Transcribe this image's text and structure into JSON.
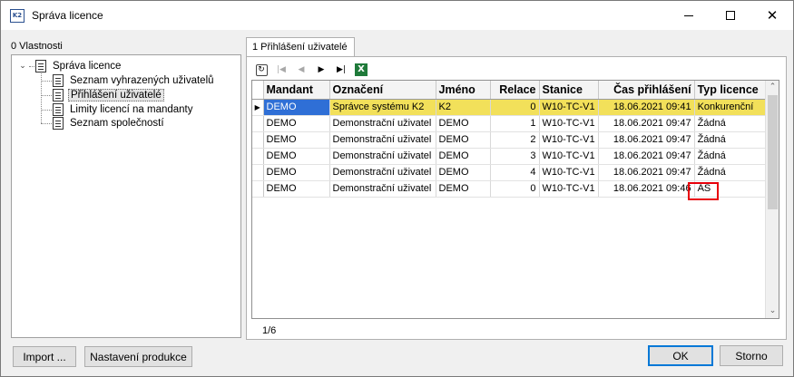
{
  "window": {
    "title": "Správa licence",
    "app_icon_text": "K2"
  },
  "left_panel": {
    "label": "0 Vlastnosti",
    "tree": {
      "root": "Správa licence",
      "children": [
        "Seznam vyhrazených uživatelů",
        "Přihlášení uživatelé",
        "Limity licencí na mandanty",
        "Seznam společností"
      ],
      "selected_index": 1
    }
  },
  "tab": {
    "label": "1 Přihlášení uživatelé"
  },
  "toolbar": {
    "icons": [
      "refresh-icon",
      "first-record-icon",
      "previous-record-icon",
      "next-record-icon",
      "last-record-icon",
      "excel-export-icon"
    ]
  },
  "grid": {
    "columns": [
      "Mandant",
      "Označení",
      "Jméno",
      "Relace",
      "Stanice",
      "Čas přihlášení",
      "Typ licence"
    ],
    "rows": [
      {
        "mandant": "DEMO",
        "oznaceni": "Správce systému K2",
        "jmeno": "K2",
        "relace": "0",
        "stanice": "W10-TC-V1",
        "cas": "18.06.2021 09:41",
        "typ": "Konkurenční"
      },
      {
        "mandant": "DEMO",
        "oznaceni": "Demonstrační uživatel",
        "jmeno": "DEMO",
        "relace": "1",
        "stanice": "W10-TC-V1",
        "cas": "18.06.2021 09:47",
        "typ": "Žádná"
      },
      {
        "mandant": "DEMO",
        "oznaceni": "Demonstrační uživatel",
        "jmeno": "DEMO",
        "relace": "2",
        "stanice": "W10-TC-V1",
        "cas": "18.06.2021 09:47",
        "typ": "Žádná"
      },
      {
        "mandant": "DEMO",
        "oznaceni": "Demonstrační uživatel",
        "jmeno": "DEMO",
        "relace": "3",
        "stanice": "W10-TC-V1",
        "cas": "18.06.2021 09:47",
        "typ": "Žádná"
      },
      {
        "mandant": "DEMO",
        "oznaceni": "Demonstrační uživatel",
        "jmeno": "DEMO",
        "relace": "4",
        "stanice": "W10-TC-V1",
        "cas": "18.06.2021 09:47",
        "typ": "Žádná"
      },
      {
        "mandant": "DEMO",
        "oznaceni": "Demonstrační uživatel",
        "jmeno": "DEMO",
        "relace": "0",
        "stanice": "W10-TC-V1",
        "cas": "18.06.2021 09:46",
        "typ": "AS"
      }
    ],
    "selected_row_color": "#f2e05a",
    "focus_cell_color": "#2f6fd6",
    "highlight_color": "#e8000b"
  },
  "status": {
    "record_count": "1/6"
  },
  "buttons": {
    "import": "Import ...",
    "product_settings": "Nastavení produkce",
    "ok": "OK",
    "cancel": "Storno"
  }
}
